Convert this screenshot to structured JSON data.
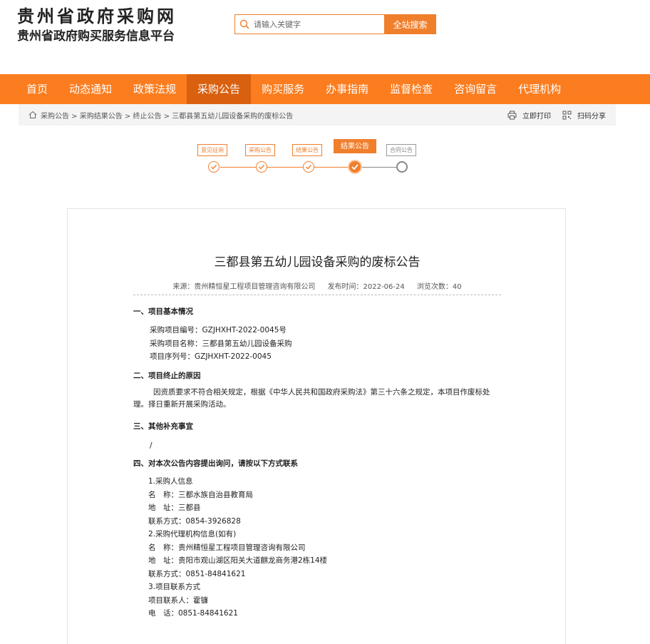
{
  "header": {
    "logo_main": "贵州省政府采购网",
    "logo_sub": "贵州省政府购买服务信息平台",
    "search_placeholder": "请输入关键字",
    "search_button": "全站搜索"
  },
  "nav": {
    "items": [
      "首页",
      "动态通知",
      "政策法规",
      "采购公告",
      "购买服务",
      "办事指南",
      "监督检查",
      "咨询留言",
      "代理机构"
    ],
    "active_index": 3
  },
  "breadcrumb": {
    "path": "采购公告 > 采购结果公告 > 终止公告 > 三都县第五幼儿园设备采购的废标公告",
    "print_label": "立即打印",
    "share_label": "扫码分享"
  },
  "steps": {
    "items": [
      "意见征询",
      "采购公告",
      "结果公告",
      "结果公告",
      "合同公告"
    ],
    "current_index": 3
  },
  "article": {
    "title": "三都县第五幼儿园设备采购的废标公告",
    "source": "来源：贵州精恒星工程项目管理咨询有限公司",
    "publish_time": "发布时间：2022-06-24",
    "views": "浏览次数：40",
    "sec1_title": "一、项目基本情况",
    "sec1_lines": [
      "采购项目编号：GZJHXHT-2022-0045号",
      "采购项目名称：三都县第五幼儿园设备采购",
      "项目序列号：GZJHXHT-2022-0045"
    ],
    "sec2_title": "二、项目终止的原因",
    "sec2_text": "因资质要求不符合相关规定，根据《中华人民共和国政府采购法》第三十六条之规定，本项目作废标处理。择日重新开展采购活动。",
    "sec3_title": "三、其他补充事宜",
    "sec3_text": "/",
    "sec4_title": "四、对本次公告内容提出询问，请按以下方式联系",
    "sec4_lines": [
      "1.采购人信息",
      "名　称：三都水族自治县教育局",
      "地　址：三都县",
      "联系方式：0854-3926828",
      "2.采购代理机构信息(如有)",
      "名　称：贵州精恒星工程项目管理咨询有限公司",
      "地　址：贵阳市观山湖区阳关大道麒龙商务港2栋14楼",
      "联系方式：0851-84841621",
      "3.项目联系方式",
      "项目联系人：霍镰",
      "电　话：0851-84841621"
    ]
  }
}
